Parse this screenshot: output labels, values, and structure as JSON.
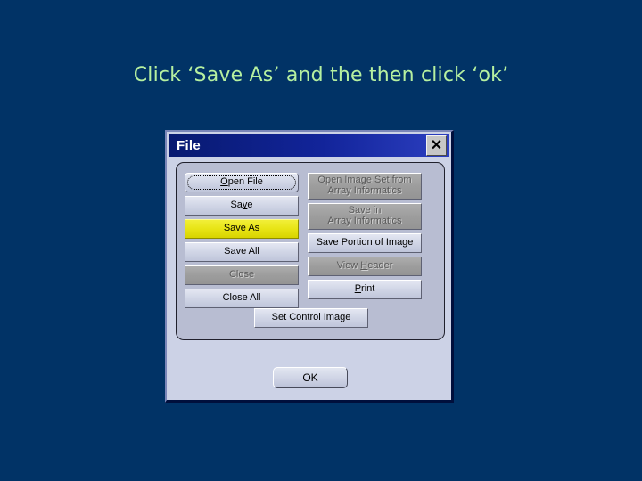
{
  "slide": {
    "title": "Click ‘Save As’ and the then click ‘ok’",
    "background_color": "#013366",
    "title_color": "#b6f0a0"
  },
  "dialog": {
    "titlebar": {
      "title": "File",
      "close_label": "✕",
      "close_icon": "close-icon",
      "gradient_start": "#081a70",
      "gradient_end": "#2c3fc0"
    },
    "body_color": "#ccd2e6",
    "group_color": "#b8bdd2",
    "left_column": [
      {
        "label": "Open File",
        "state": "focused",
        "mnemonic": "O"
      },
      {
        "label": "Save",
        "state": "enabled",
        "mnemonic": "v"
      },
      {
        "label": "Save As",
        "state": "highlighted",
        "highlight_color": "#e8e415"
      },
      {
        "label": "Save All",
        "state": "enabled"
      },
      {
        "label": "Close",
        "state": "disabled"
      },
      {
        "label": "Close All",
        "state": "enabled"
      }
    ],
    "right_column": [
      {
        "label": "Open Image Set from\nArray Informatics",
        "state": "disabled"
      },
      {
        "label": "Save in\nArray Informatics",
        "state": "disabled"
      },
      {
        "label": "Save Portion of Image",
        "state": "enabled"
      },
      {
        "label": "View Header",
        "state": "disabled",
        "mnemonic": "H"
      },
      {
        "label": "Print",
        "state": "enabled",
        "mnemonic": "P"
      }
    ],
    "set_control_button": {
      "label": "Set Control Image",
      "state": "enabled"
    },
    "ok_button": {
      "label": "OK",
      "state": "enabled"
    }
  }
}
